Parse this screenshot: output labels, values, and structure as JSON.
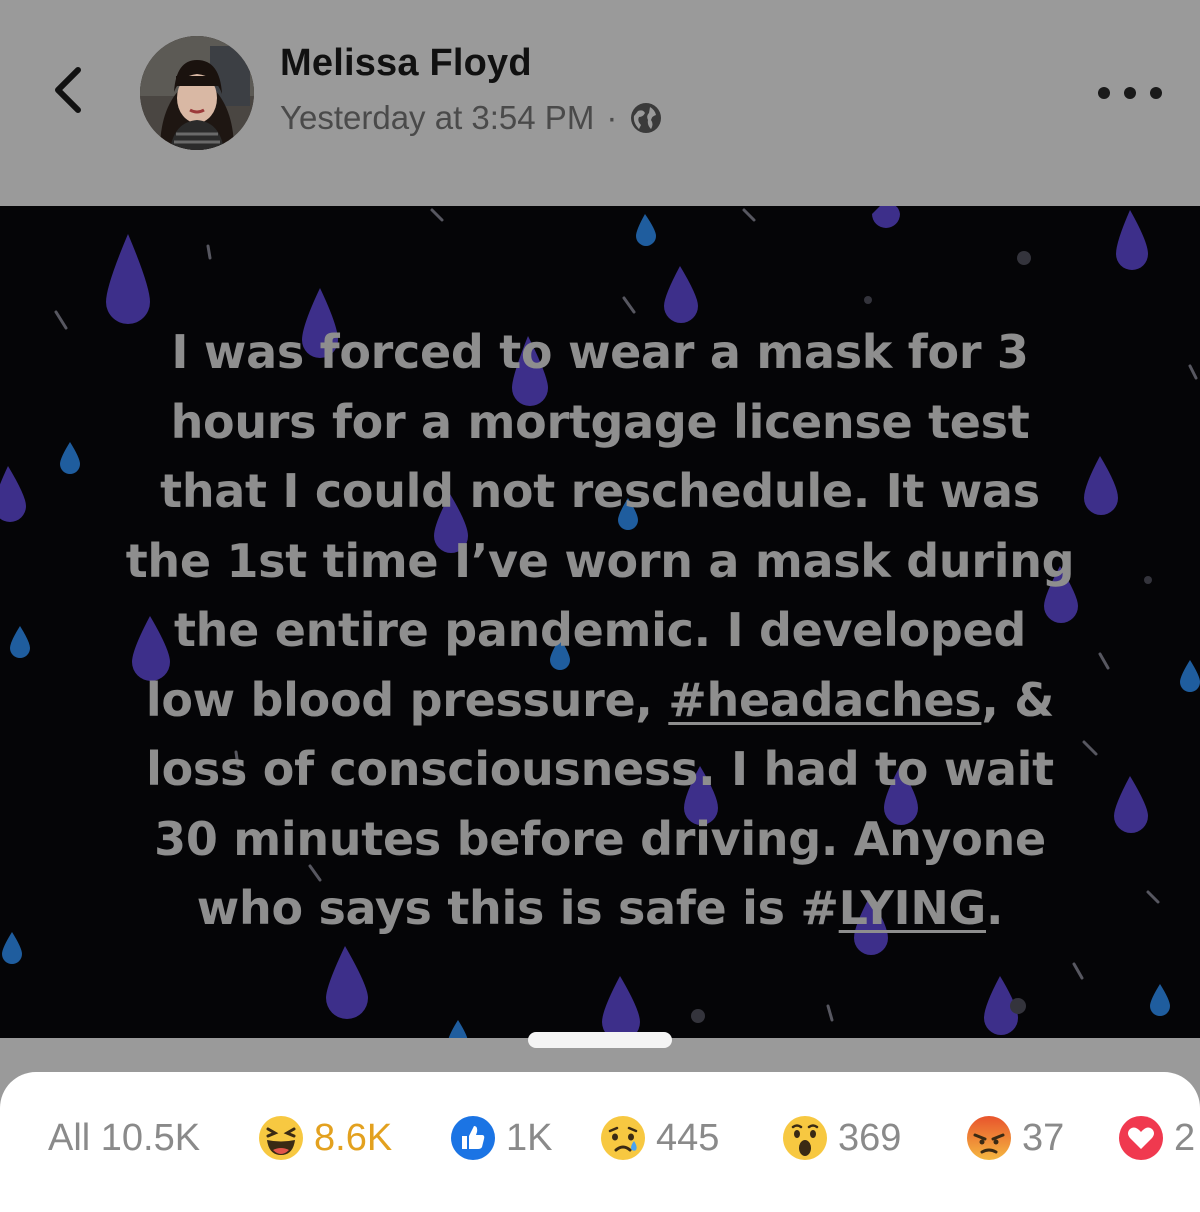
{
  "header": {
    "author_name": "Melissa Floyd",
    "timestamp": "Yesterday at 3:54 PM",
    "separator": "·",
    "privacy_icon": "globe-icon",
    "back_icon": "chevron-left-icon",
    "more_icon": "more-horizontal-icon"
  },
  "post": {
    "line_1": "I was forced to wear a mask for 3",
    "line_2": "hours for a mortgage license test",
    "line_3": "that I could not reschedule.  It was",
    "line_4": "the 1st time I’ve worn a mask during",
    "line_5": "the entire pandemic.  I developed",
    "line_6a": "low blood pressure, ",
    "hashtag_1": "#headaches",
    "line_6b": ", &",
    "line_7": "loss of consciousness.  I had to wait",
    "line_8": "30 minutes before driving.  Anyone",
    "line_9a": "who says this is safe is ",
    "hashtag_2_prefix": "#",
    "hashtag_2": "LYING",
    "line_9b": "."
  },
  "reactions": {
    "all_label": "All 10.5K",
    "items": [
      {
        "icon": "haha-icon",
        "count": "8.6K"
      },
      {
        "icon": "like-icon",
        "count": "1K"
      },
      {
        "icon": "sad-icon",
        "count": "445"
      },
      {
        "icon": "wow-icon",
        "count": "369"
      },
      {
        "icon": "angry-icon",
        "count": "37"
      },
      {
        "icon": "love-icon",
        "count": "2"
      }
    ]
  },
  "colors": {
    "header_bg": "#9a9a9a",
    "post_bg": "#050507",
    "post_text": "#8e8e8e",
    "haha_accent": "#e3a11f",
    "rain_purple": "#3d2f8a",
    "rain_blue": "#1f5d9e"
  }
}
